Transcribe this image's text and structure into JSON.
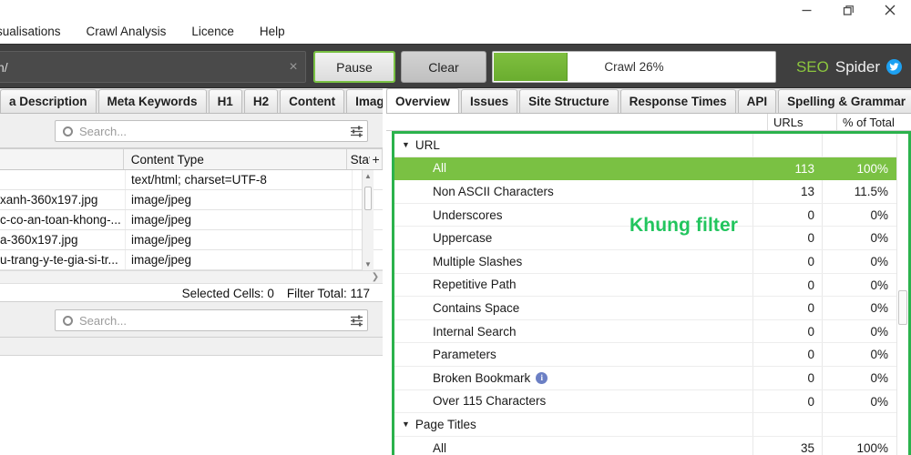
{
  "window": {
    "controls": [
      {
        "name": "minimize",
        "glyph": "minimize-icon"
      },
      {
        "name": "restore",
        "glyph": "restore-icon"
      },
      {
        "name": "close",
        "glyph": "close-icon"
      }
    ]
  },
  "menubar": {
    "items": [
      "sualisations",
      "Crawl Analysis",
      "Licence",
      "Help"
    ]
  },
  "toolbar": {
    "url_value": "n/",
    "url_clear_glyph": "×",
    "pause_label": "Pause",
    "clear_label": "Clear",
    "progress_label": "Crawl 26%",
    "progress_percent": 26,
    "brand_primary": "SEO",
    "brand_secondary": "Spider",
    "brand_color": "#8cc63e",
    "twitter_color": "#1da1f2"
  },
  "left_panel": {
    "tabs": [
      {
        "label": "a Description",
        "active": false
      },
      {
        "label": "Meta Keywords",
        "active": false
      },
      {
        "label": "H1",
        "active": false
      },
      {
        "label": "H2",
        "active": false
      },
      {
        "label": "Content",
        "active": false
      },
      {
        "label": "Images",
        "active": false
      }
    ],
    "tab_overflow_glyph": "▼",
    "search_placeholder": "Search...",
    "table": {
      "columns": [
        "",
        "Content Type",
        "Stat",
        "+"
      ],
      "rows": [
        {
          "address": "",
          "content_type": "text/html; charset=UTF-8"
        },
        {
          "address": "xanh-360x197.jpg",
          "content_type": "image/jpeg"
        },
        {
          "address": "c-co-an-toan-khong-...",
          "content_type": "image/jpeg"
        },
        {
          "address": "a-360x197.jpg",
          "content_type": "image/jpeg"
        },
        {
          "address": "u-trang-y-te-gia-si-tr...",
          "content_type": "image/jpeg"
        }
      ]
    },
    "status": {
      "selected_cells_label": "Selected Cells:",
      "selected_cells_value": "0",
      "filter_total_label": "Filter Total:",
      "filter_total_value": "117"
    },
    "lower_search_placeholder": "Search..."
  },
  "right_panel": {
    "tabs": [
      {
        "label": "Overview",
        "active": true
      },
      {
        "label": "Issues",
        "active": false
      },
      {
        "label": "Site Structure",
        "active": false
      },
      {
        "label": "Response Times",
        "active": false
      },
      {
        "label": "API",
        "active": false
      },
      {
        "label": "Spelling & Grammar",
        "active": false
      }
    ],
    "tab_overflow_glyph": "▼",
    "columns": {
      "name": "",
      "urls": "URLs",
      "percent": "% of Total"
    },
    "highlight_color": "#2bb24c",
    "selected_row_color": "#7ac143",
    "tree": [
      {
        "type": "group",
        "label": "URL",
        "caret": "▼",
        "urls": "",
        "percent": "",
        "selected": false
      },
      {
        "type": "child",
        "label": "All",
        "urls": "113",
        "percent": "100%",
        "selected": true
      },
      {
        "type": "child",
        "label": "Non ASCII Characters",
        "urls": "13",
        "percent": "11.5%",
        "selected": false
      },
      {
        "type": "child",
        "label": "Underscores",
        "urls": "0",
        "percent": "0%",
        "selected": false
      },
      {
        "type": "child",
        "label": "Uppercase",
        "urls": "0",
        "percent": "0%",
        "selected": false
      },
      {
        "type": "child",
        "label": "Multiple Slashes",
        "urls": "0",
        "percent": "0%",
        "selected": false
      },
      {
        "type": "child",
        "label": "Repetitive Path",
        "urls": "0",
        "percent": "0%",
        "selected": false
      },
      {
        "type": "child",
        "label": "Contains Space",
        "urls": "0",
        "percent": "0%",
        "selected": false
      },
      {
        "type": "child",
        "label": "Internal Search",
        "urls": "0",
        "percent": "0%",
        "selected": false
      },
      {
        "type": "child",
        "label": "Parameters",
        "urls": "0",
        "percent": "0%",
        "selected": false
      },
      {
        "type": "child",
        "label": "Broken Bookmark",
        "urls": "0",
        "percent": "0%",
        "selected": false,
        "info": true
      },
      {
        "type": "child",
        "label": "Over 115 Characters",
        "urls": "0",
        "percent": "0%",
        "selected": false
      },
      {
        "type": "group",
        "label": "Page Titles",
        "caret": "▼",
        "urls": "",
        "percent": "",
        "selected": false
      },
      {
        "type": "child",
        "label": "All",
        "urls": "35",
        "percent": "100%",
        "selected": false
      }
    ]
  },
  "annotation": {
    "text": "Khung filter",
    "color": "#22c55e"
  }
}
